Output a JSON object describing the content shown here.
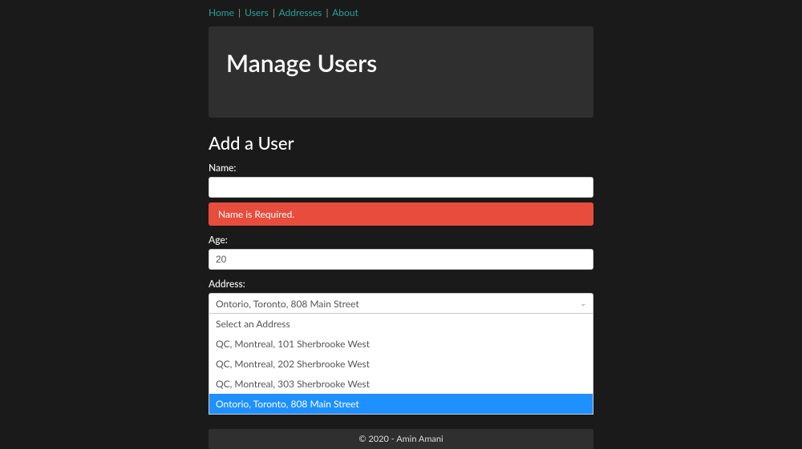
{
  "nav": {
    "items": [
      "Home",
      "Users",
      "Addresses",
      "About"
    ]
  },
  "header": {
    "title": "Manage Users"
  },
  "form": {
    "title": "Add a User",
    "name_label": "Name:",
    "name_value": "",
    "name_error": "Name is Required.",
    "age_label": "Age:",
    "age_value": "20",
    "address_label": "Address:",
    "address_selected": "Ontorio, Toronto, 808 Main Street",
    "address_options": [
      "Select an Address",
      "QC, Montreal, 101 Sherbrooke West",
      "QC, Montreal, 202 Sherbrooke West",
      "QC, Montreal, 303 Sherbrooke West",
      "Ontorio, Toronto, 808 Main Street"
    ],
    "address_selected_index": 4
  },
  "footer": {
    "text": "© 2020 - Amin Amani"
  }
}
